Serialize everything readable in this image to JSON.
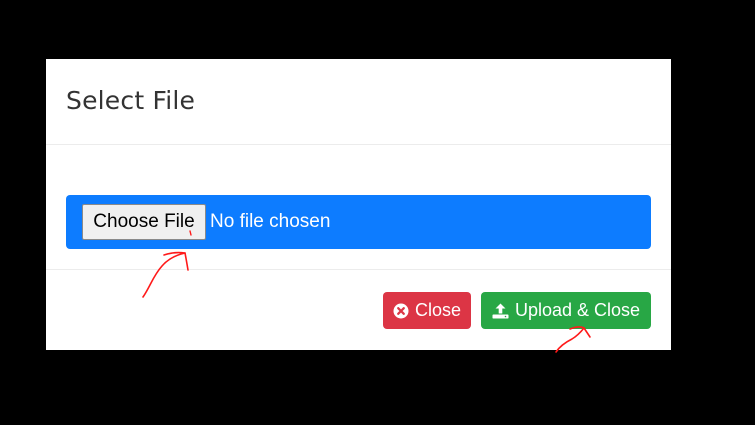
{
  "modal": {
    "title": "Select File"
  },
  "file_input": {
    "button_label": "Choose File",
    "status_text": "No file chosen"
  },
  "footer": {
    "close_label": "Close",
    "close_icon": "times-circle-icon",
    "upload_label": "Upload & Close",
    "upload_icon": "upload-icon"
  },
  "colors": {
    "backdrop": "#000000",
    "file_bar": "#0d7cff",
    "close_button": "#dc3545",
    "upload_button": "#28a745",
    "annotation": "#ff0000"
  },
  "annotations": [
    {
      "type": "hand-drawn-arrow",
      "points_to": "choose-file-button"
    },
    {
      "type": "hand-drawn-arrow",
      "points_to": "upload-close-button"
    }
  ]
}
